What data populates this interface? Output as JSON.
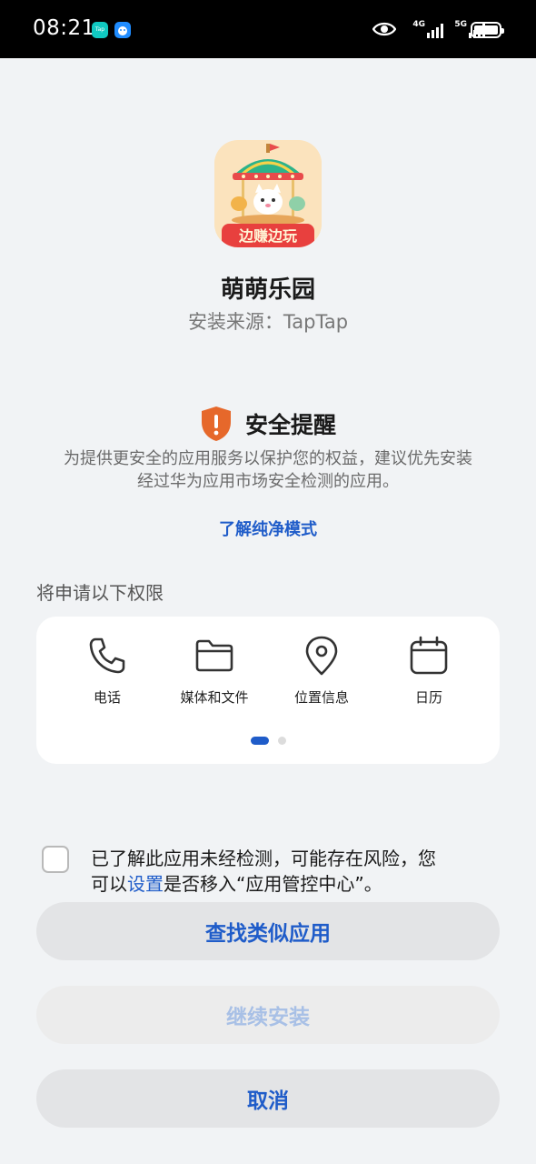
{
  "status_bar": {
    "time": "08:21",
    "app1_label": "Tap",
    "net1": "4G",
    "net2": "5G"
  },
  "app": {
    "name": "萌萌乐园",
    "source": "安装来源：TapTap",
    "icon_banner": "边赚边玩"
  },
  "alert": {
    "title": "安全提醒",
    "desc_line1": "为提供更安全的应用服务以保护您的权益，建议优先安装",
    "desc_line2": "经过华为应用市场安全检测的应用。",
    "learn_more": "了解纯净模式"
  },
  "permissions": {
    "title": "将申请以下权限",
    "items": [
      {
        "label": "电话",
        "icon": "phone-icon"
      },
      {
        "label": "媒体和文件",
        "icon": "folder-icon"
      },
      {
        "label": "位置信息",
        "icon": "location-icon"
      },
      {
        "label": "日历",
        "icon": "calendar-icon"
      }
    ],
    "page_count": 2,
    "current_page": 1
  },
  "consent": {
    "text_line1": "已了解此应用未经检测，可能存在风险，您",
    "text_prefix": "可以",
    "link": "设置",
    "text_suffix": "是否移入“应用管控中心”。",
    "checked": false
  },
  "buttons": {
    "find_similar": "查找类似应用",
    "continue_install": "继续安装",
    "cancel": "取消"
  },
  "colors": {
    "accent": "#1f5cc9",
    "shield": "#e6682b",
    "background": "#f1f3f5"
  }
}
